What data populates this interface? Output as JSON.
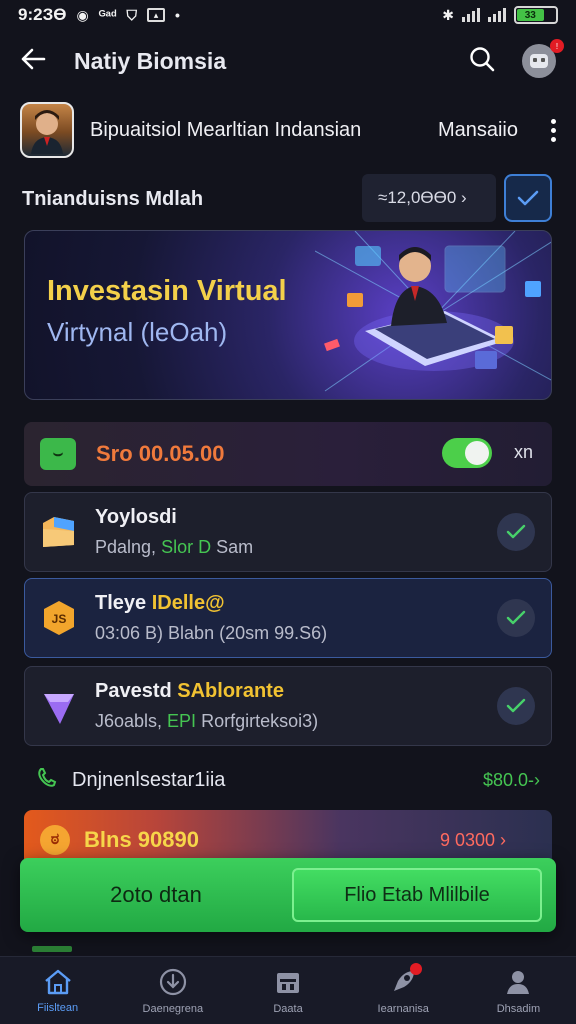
{
  "status_bar": {
    "time": "9:2ЗӨ",
    "battery": "33"
  },
  "app_bar": {
    "title": "Natiy Biomsia"
  },
  "profile": {
    "name": "Bipuaitsiol Mearltian Indansian",
    "secondary": "Mansaiio"
  },
  "balance": {
    "label": "Tnianduisns Mdlah",
    "amount": "≈12,0ӨӨ0 ›"
  },
  "banner": {
    "title": "Investasin Virtual",
    "subtitle": "Virtynal (leOah)"
  },
  "promo": {
    "amount": "Sro 00.05.00",
    "suffix": "xn",
    "toggle_on": true
  },
  "cards": [
    {
      "title": "Yoylosdi",
      "sub_a": "Pdalng, ",
      "sub_b": "Slor D",
      "sub_c": " Sam",
      "checked": true
    },
    {
      "title": "Tleye ",
      "title_b": "IDelle@",
      "sub": "03:06 B) Blabn (20sm 99.S6)",
      "checked": true
    },
    {
      "title": "Pavestd ",
      "title_b": "SAblorante",
      "sub_a": "J6oabls, ",
      "sub_b": "EPI",
      "sub_c": " Rorfgirteksoi3)",
      "checked": true
    }
  ],
  "transaction": {
    "label": "Dnjnenlsestar1iia",
    "amount": "$80.0-›"
  },
  "alert_card": {
    "label": "Blns 90890",
    "amount": "9 0300 ›"
  },
  "cta": {
    "left_label": "2oto dtan",
    "button_label": "Flio Etab Mlilbile"
  },
  "nav": {
    "items": [
      {
        "label": "Fiisltean",
        "icon": "home-icon",
        "active": true
      },
      {
        "label": "Daenegrena",
        "icon": "compass-icon",
        "active": false
      },
      {
        "label": "Daata",
        "icon": "calendar-icon",
        "active": false
      },
      {
        "label": "Iearnanisa",
        "icon": "rocket-icon",
        "active": false,
        "badge": true
      },
      {
        "label": "Dhsadim",
        "icon": "user-icon",
        "active": false
      }
    ]
  },
  "colors": {
    "accent_green": "#3ccf5c",
    "accent_blue": "#5b9cf5",
    "highlight_yellow": "#f1c232",
    "alert_orange": "#e35a1c"
  }
}
